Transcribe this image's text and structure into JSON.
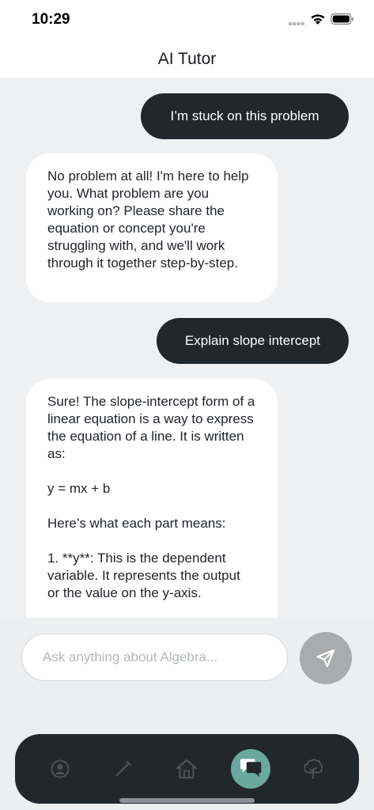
{
  "status_bar": {
    "time": "10:29"
  },
  "header": {
    "title": "AI Tutor"
  },
  "messages": [
    {
      "role": "user",
      "text": "I’m stuck on this problem"
    },
    {
      "role": "assistant",
      "text": "No problem at all! I'm here to help you. What problem are you working on? Please share the equation or concept you're struggling with, and we'll work through it together step-by-step."
    },
    {
      "role": "user",
      "text": "Explain slope intercept"
    },
    {
      "role": "assistant",
      "text": "Sure! The slope-intercept form of a linear equation is a way to express the equation of a line. It is written as:\n\ny = mx + b\n\nHere’s what each part means:\n\n1. **y**: This is the dependent variable. It represents the output or the value on the y-axis."
    }
  ],
  "composer": {
    "placeholder": "Ask anything about Algebra..."
  },
  "nav": {
    "items": [
      "profile-icon",
      "pencil-icon",
      "home-icon",
      "chat-icon",
      "tree-icon"
    ],
    "active": "chat-icon"
  },
  "colors": {
    "user_bubble": "#22272b",
    "assistant_bubble": "#ffffff",
    "nav_active": "#6aa99e",
    "send_disabled": "#a9abad"
  }
}
